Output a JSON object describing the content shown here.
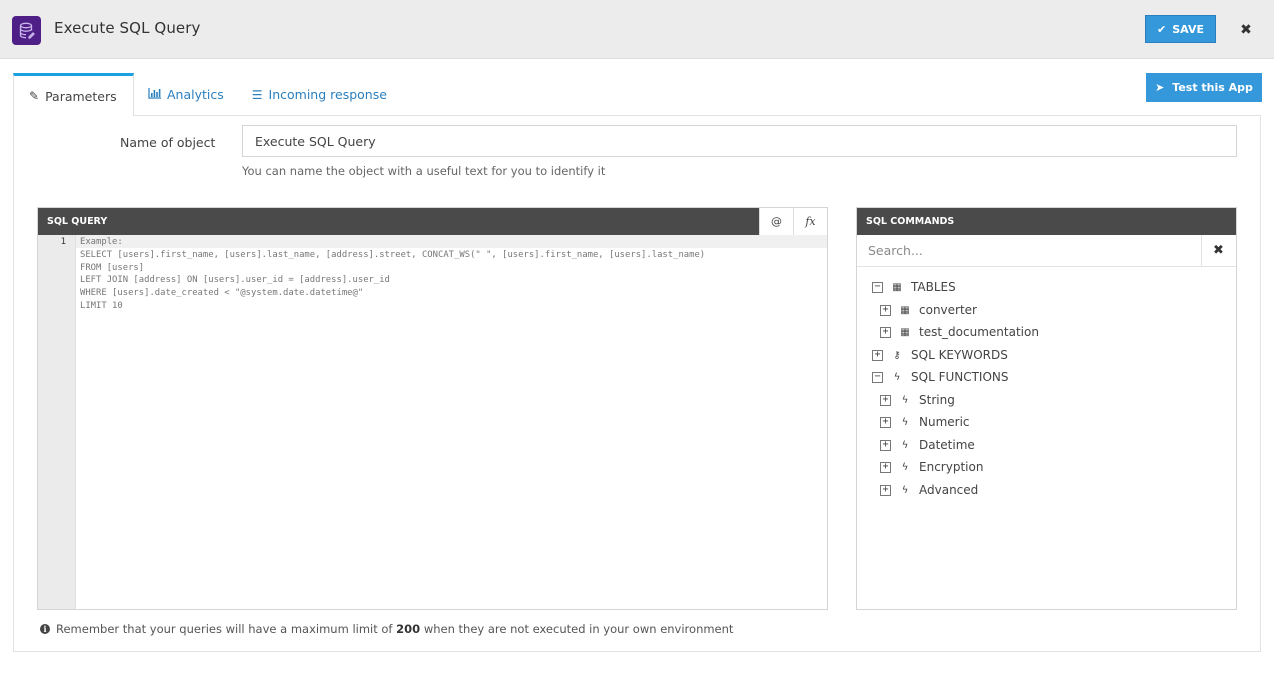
{
  "header": {
    "title": "Execute SQL Query",
    "app_icon": "database-icon",
    "app_icon_color": "#4e1f86",
    "save_label": "SAVE",
    "save_icon": "check-icon",
    "close_icon": "close-icon",
    "accent_color": "#3498db"
  },
  "tabs": [
    {
      "label": "Parameters",
      "icon": "edit-icon",
      "active": true
    },
    {
      "label": "Analytics",
      "icon": "bar-chart-icon",
      "active": false
    },
    {
      "label": "Incoming response",
      "icon": "list-icon",
      "active": false
    }
  ],
  "test_button": {
    "label": "Test this App",
    "icon": "rocket-icon"
  },
  "form": {
    "name_label": "Name of object",
    "name_value": "Execute SQL Query",
    "name_help": "You can name the object with a useful text for you to identify it"
  },
  "sql_editor": {
    "title": "SQL QUERY",
    "at_button": "@",
    "fx_button": "fx",
    "line_number": "1",
    "code_lines": [
      "Example:",
      "SELECT [users].first_name, [users].last_name, [address].street, CONCAT_WS(\" \", [users].first_name, [users].last_name)",
      "FROM [users]",
      "LEFT JOIN [address] ON [users].user_id = [address].user_id",
      "WHERE [users].date_created < \"@system.date.datetime@\"",
      "LIMIT 10"
    ]
  },
  "sql_commands": {
    "title": "SQL COMMANDS",
    "search_placeholder": "Search...",
    "search_value": "",
    "tree": [
      {
        "label": "TABLES",
        "icon": "table-icon",
        "toggle": "−",
        "level": 0
      },
      {
        "label": "converter",
        "icon": "table-icon",
        "toggle": "+",
        "level": 1
      },
      {
        "label": "test_documentation",
        "icon": "table-icon",
        "toggle": "+",
        "level": 1
      },
      {
        "label": "SQL KEYWORDS",
        "icon": "key-icon",
        "toggle": "+",
        "level": 0
      },
      {
        "label": "SQL FUNCTIONS",
        "icon": "bolt-icon",
        "toggle": "−",
        "level": 0
      },
      {
        "label": "String",
        "icon": "bolt-icon",
        "toggle": "+",
        "level": 1
      },
      {
        "label": "Numeric",
        "icon": "bolt-icon",
        "toggle": "+",
        "level": 1
      },
      {
        "label": "Datetime",
        "icon": "bolt-icon",
        "toggle": "+",
        "level": 1
      },
      {
        "label": "Encryption",
        "icon": "bolt-icon",
        "toggle": "+",
        "level": 1
      },
      {
        "label": "Advanced",
        "icon": "bolt-icon",
        "toggle": "+",
        "level": 1
      }
    ]
  },
  "notice": {
    "prefix": "Remember that your queries will have a maximum limit of",
    "limit": "200",
    "suffix": "when they are not executed in your own environment"
  }
}
